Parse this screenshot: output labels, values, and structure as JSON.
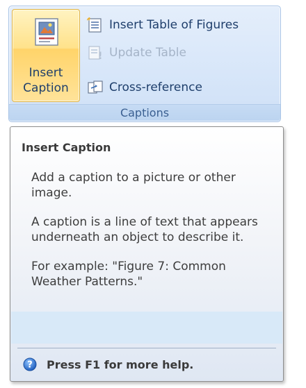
{
  "ribbon": {
    "group_label": "Captions",
    "insert_caption": {
      "line1": "Insert",
      "line2": "Caption",
      "icon": "insert-caption-icon"
    },
    "insert_table_of_figures": {
      "label": "Insert Table of Figures",
      "icon": "table-of-figures-icon"
    },
    "update_table": {
      "label": "Update Table",
      "icon": "update-table-icon",
      "enabled": false
    },
    "cross_reference": {
      "label": "Cross-reference",
      "icon": "cross-reference-icon"
    }
  },
  "tooltip": {
    "title": "Insert Caption",
    "para1": "Add a caption to a picture or other image.",
    "para2": "A caption is a line of text that appears underneath an object to describe it.",
    "para3": "For example: \"Figure 7: Common Weather Patterns.\"",
    "help_text": "Press F1 for more help.",
    "help_icon": "help-icon"
  },
  "colors": {
    "accent_text": "#1e3e6b",
    "hover_gold": "#ffd46a",
    "ribbon_blue": "#d7e6f9",
    "help_blue": "#2a6fc9"
  }
}
